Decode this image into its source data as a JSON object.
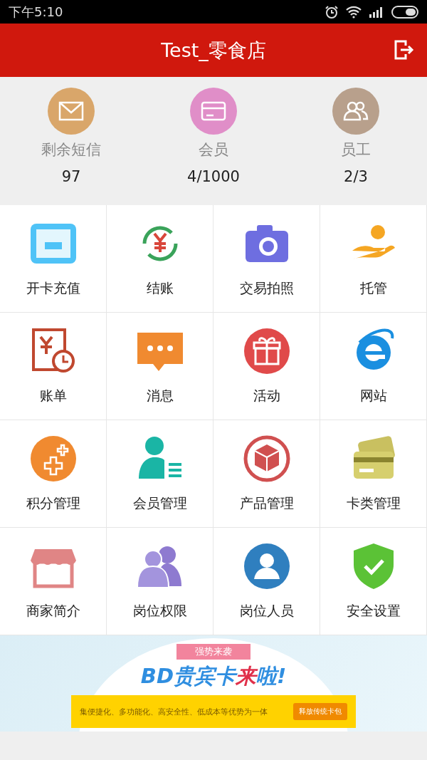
{
  "status_bar": {
    "time": "下午5:10"
  },
  "header": {
    "title": "Test_零食店"
  },
  "stats": [
    {
      "label": "剩余短信",
      "value": "97",
      "color": "#d9a66a"
    },
    {
      "label": "会员",
      "value": "4/1000",
      "color": "#e08ec8"
    },
    {
      "label": "员工",
      "value": "2/3",
      "color": "#b8a08c"
    }
  ],
  "menu": [
    {
      "label": "开卡充值"
    },
    {
      "label": "结账"
    },
    {
      "label": "交易拍照"
    },
    {
      "label": "托管"
    },
    {
      "label": "账单"
    },
    {
      "label": "消息"
    },
    {
      "label": "活动"
    },
    {
      "label": "网站"
    },
    {
      "label": "积分管理"
    },
    {
      "label": "会员管理"
    },
    {
      "label": "产品管理"
    },
    {
      "label": "卡类管理"
    },
    {
      "label": "商家简介"
    },
    {
      "label": "岗位权限"
    },
    {
      "label": "岗位人员"
    },
    {
      "label": "安全设置"
    }
  ],
  "banner": {
    "tag": "强势来袭",
    "title": [
      {
        "text": "BD贵宾卡",
        "accent": false
      },
      {
        "text": "来",
        "accent": true
      },
      {
        "text": "啦!",
        "accent": false
      }
    ],
    "slogan": "集便捷化、多功能化、高安全性、低成本等优势为一体",
    "button": "释放传统卡包"
  }
}
